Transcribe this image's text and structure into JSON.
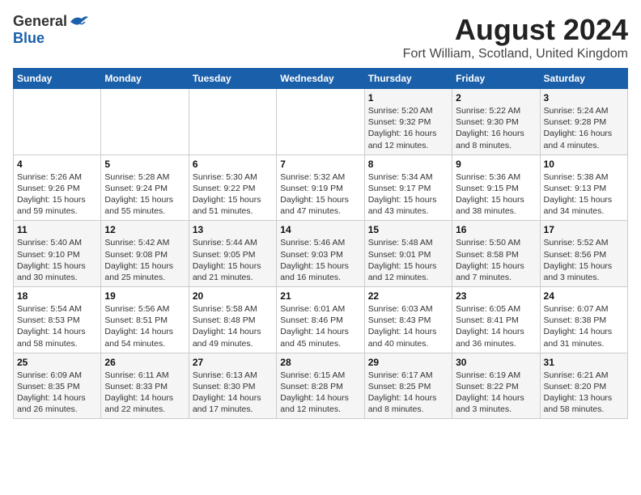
{
  "header": {
    "logo_general": "General",
    "logo_blue": "Blue",
    "month_title": "August 2024",
    "location": "Fort William, Scotland, United Kingdom"
  },
  "days_of_week": [
    "Sunday",
    "Monday",
    "Tuesday",
    "Wednesday",
    "Thursday",
    "Friday",
    "Saturday"
  ],
  "weeks": [
    [
      {
        "day": "",
        "info": ""
      },
      {
        "day": "",
        "info": ""
      },
      {
        "day": "",
        "info": ""
      },
      {
        "day": "",
        "info": ""
      },
      {
        "day": "1",
        "info": "Sunrise: 5:20 AM\nSunset: 9:32 PM\nDaylight: 16 hours\nand 12 minutes."
      },
      {
        "day": "2",
        "info": "Sunrise: 5:22 AM\nSunset: 9:30 PM\nDaylight: 16 hours\nand 8 minutes."
      },
      {
        "day": "3",
        "info": "Sunrise: 5:24 AM\nSunset: 9:28 PM\nDaylight: 16 hours\nand 4 minutes."
      }
    ],
    [
      {
        "day": "4",
        "info": "Sunrise: 5:26 AM\nSunset: 9:26 PM\nDaylight: 15 hours\nand 59 minutes."
      },
      {
        "day": "5",
        "info": "Sunrise: 5:28 AM\nSunset: 9:24 PM\nDaylight: 15 hours\nand 55 minutes."
      },
      {
        "day": "6",
        "info": "Sunrise: 5:30 AM\nSunset: 9:22 PM\nDaylight: 15 hours\nand 51 minutes."
      },
      {
        "day": "7",
        "info": "Sunrise: 5:32 AM\nSunset: 9:19 PM\nDaylight: 15 hours\nand 47 minutes."
      },
      {
        "day": "8",
        "info": "Sunrise: 5:34 AM\nSunset: 9:17 PM\nDaylight: 15 hours\nand 43 minutes."
      },
      {
        "day": "9",
        "info": "Sunrise: 5:36 AM\nSunset: 9:15 PM\nDaylight: 15 hours\nand 38 minutes."
      },
      {
        "day": "10",
        "info": "Sunrise: 5:38 AM\nSunset: 9:13 PM\nDaylight: 15 hours\nand 34 minutes."
      }
    ],
    [
      {
        "day": "11",
        "info": "Sunrise: 5:40 AM\nSunset: 9:10 PM\nDaylight: 15 hours\nand 30 minutes."
      },
      {
        "day": "12",
        "info": "Sunrise: 5:42 AM\nSunset: 9:08 PM\nDaylight: 15 hours\nand 25 minutes."
      },
      {
        "day": "13",
        "info": "Sunrise: 5:44 AM\nSunset: 9:05 PM\nDaylight: 15 hours\nand 21 minutes."
      },
      {
        "day": "14",
        "info": "Sunrise: 5:46 AM\nSunset: 9:03 PM\nDaylight: 15 hours\nand 16 minutes."
      },
      {
        "day": "15",
        "info": "Sunrise: 5:48 AM\nSunset: 9:01 PM\nDaylight: 15 hours\nand 12 minutes."
      },
      {
        "day": "16",
        "info": "Sunrise: 5:50 AM\nSunset: 8:58 PM\nDaylight: 15 hours\nand 7 minutes."
      },
      {
        "day": "17",
        "info": "Sunrise: 5:52 AM\nSunset: 8:56 PM\nDaylight: 15 hours\nand 3 minutes."
      }
    ],
    [
      {
        "day": "18",
        "info": "Sunrise: 5:54 AM\nSunset: 8:53 PM\nDaylight: 14 hours\nand 58 minutes."
      },
      {
        "day": "19",
        "info": "Sunrise: 5:56 AM\nSunset: 8:51 PM\nDaylight: 14 hours\nand 54 minutes."
      },
      {
        "day": "20",
        "info": "Sunrise: 5:58 AM\nSunset: 8:48 PM\nDaylight: 14 hours\nand 49 minutes."
      },
      {
        "day": "21",
        "info": "Sunrise: 6:01 AM\nSunset: 8:46 PM\nDaylight: 14 hours\nand 45 minutes."
      },
      {
        "day": "22",
        "info": "Sunrise: 6:03 AM\nSunset: 8:43 PM\nDaylight: 14 hours\nand 40 minutes."
      },
      {
        "day": "23",
        "info": "Sunrise: 6:05 AM\nSunset: 8:41 PM\nDaylight: 14 hours\nand 36 minutes."
      },
      {
        "day": "24",
        "info": "Sunrise: 6:07 AM\nSunset: 8:38 PM\nDaylight: 14 hours\nand 31 minutes."
      }
    ],
    [
      {
        "day": "25",
        "info": "Sunrise: 6:09 AM\nSunset: 8:35 PM\nDaylight: 14 hours\nand 26 minutes."
      },
      {
        "day": "26",
        "info": "Sunrise: 6:11 AM\nSunset: 8:33 PM\nDaylight: 14 hours\nand 22 minutes."
      },
      {
        "day": "27",
        "info": "Sunrise: 6:13 AM\nSunset: 8:30 PM\nDaylight: 14 hours\nand 17 minutes."
      },
      {
        "day": "28",
        "info": "Sunrise: 6:15 AM\nSunset: 8:28 PM\nDaylight: 14 hours\nand 12 minutes."
      },
      {
        "day": "29",
        "info": "Sunrise: 6:17 AM\nSunset: 8:25 PM\nDaylight: 14 hours\nand 8 minutes."
      },
      {
        "day": "30",
        "info": "Sunrise: 6:19 AM\nSunset: 8:22 PM\nDaylight: 14 hours\nand 3 minutes."
      },
      {
        "day": "31",
        "info": "Sunrise: 6:21 AM\nSunset: 8:20 PM\nDaylight: 13 hours\nand 58 minutes."
      }
    ]
  ]
}
